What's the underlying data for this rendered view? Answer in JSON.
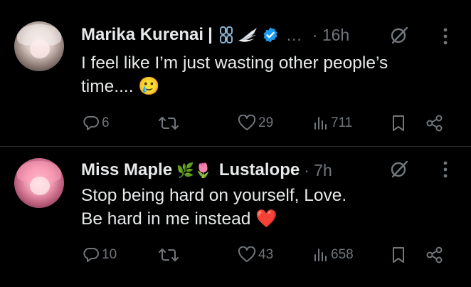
{
  "tweets": [
    {
      "author": "Marika Kurenai",
      "separator": "|",
      "ellipsis": "…",
      "time": "· 16h",
      "text_line1": "I feel like I’m just wasting other people’s",
      "text_line2": "time.... 🥲",
      "replies": "6",
      "likes": "29",
      "views": "711",
      "badge_icons": [
        "chain-icon",
        "wing-icon",
        "verified-icon"
      ]
    },
    {
      "author": "Miss Maple",
      "author_emoji": "🌿🌷",
      "author_extra": "Lustalope",
      "time": "· 7h",
      "text_line1": "Stop being hard on yourself, Love.",
      "text_line2": "Be hard in me instead ❤️",
      "replies": "10",
      "likes": "43",
      "views": "658"
    }
  ],
  "colors": {
    "background": "#000000",
    "text": "#e7e9ea",
    "muted": "#71767b",
    "verified": "#1d9bf0",
    "divider": "#2f3336"
  }
}
